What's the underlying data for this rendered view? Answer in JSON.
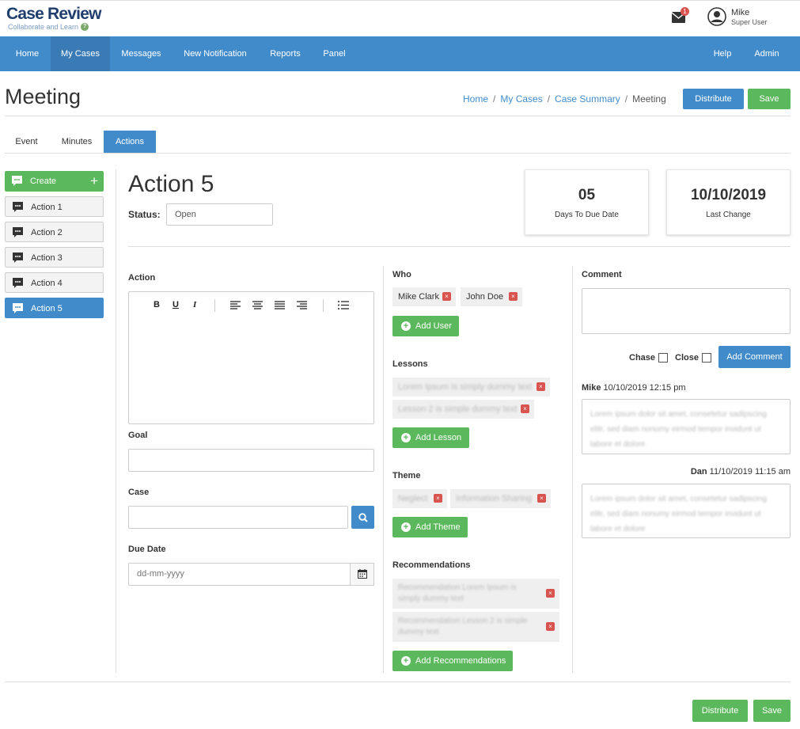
{
  "logo": {
    "title": "Case Review",
    "subtitle": "Collaborate and Learn"
  },
  "header": {
    "mail_count": "1",
    "user_name": "Mike",
    "user_role": "Super User"
  },
  "nav": {
    "items": [
      "Home",
      "My Cases",
      "Messages",
      "New Notification",
      "Reports",
      "Panel"
    ],
    "right_items": [
      "Help",
      "Admin"
    ],
    "active": "My Cases"
  },
  "page": {
    "title": "Meeting",
    "breadcrumb": [
      "Home",
      "My Cases",
      "Case Summary",
      "Meeting"
    ],
    "distribute_label": "Distribute",
    "save_label": "Save"
  },
  "tabs": [
    "Event",
    "Minutes",
    "Actions"
  ],
  "sidebar": {
    "create_label": "Create",
    "items": [
      "Action 1",
      "Action 2",
      "Action 3",
      "Action 4",
      "Action 5"
    ]
  },
  "action": {
    "title": "Action 5",
    "status_label": "Status:",
    "status_value": "Open",
    "due_days": "05",
    "due_days_label": "Days To Due Date",
    "last_change": "10/10/2019",
    "last_change_label": "Last Change"
  },
  "form": {
    "action_label": "Action",
    "goal_label": "Goal",
    "case_label": "Case",
    "due_date_label": "Due Date",
    "due_date_placeholder": "dd-mm-yyyy"
  },
  "who": {
    "label": "Who",
    "people": [
      "Mike Clark",
      "John Doe"
    ],
    "add_label": "Add User"
  },
  "lessons": {
    "label": "Lessons",
    "items": [
      "Lorem Ipsum is simply dummy text",
      "Lesson 2 is simple dummy text"
    ],
    "add_label": "Add Lesson"
  },
  "theme": {
    "label": "Theme",
    "items": [
      "Neglect",
      "Information Sharing"
    ],
    "add_label": "Add Theme"
  },
  "recommendations": {
    "label": "Recommendations",
    "items": [
      "Recommendation Lorem Ipsum is simply dummy text",
      "Recommendation Lesson 2 is simple dummy text"
    ],
    "add_label": "Add Recommendations"
  },
  "comments": {
    "label": "Comment",
    "chase_label": "Chase",
    "close_label": "Close",
    "add_label": "Add Comment",
    "entries": [
      {
        "author": "Mike",
        "time": "10/10/2019 12:15 pm",
        "text": "Lorem ipsum dolor sit amet, consetetur sadipscing elitr, sed diam nonumy eirmod tempor invidunt ut labore et dolore"
      },
      {
        "author": "Dan",
        "time": "11/10/2019 11:15 am",
        "text": "Lorem ipsum dolor sit amet, consetetur sadipscing elitr, sed diam nonumy eirmod tempor invidunt ut labore et dolore"
      }
    ]
  },
  "footer": {
    "distribute_label": "Distribute",
    "save_label": "Save"
  },
  "colors": {
    "primary": "#428bca",
    "success": "#5cb85c",
    "danger": "#d9534f",
    "brand": "#1f3e6e"
  }
}
